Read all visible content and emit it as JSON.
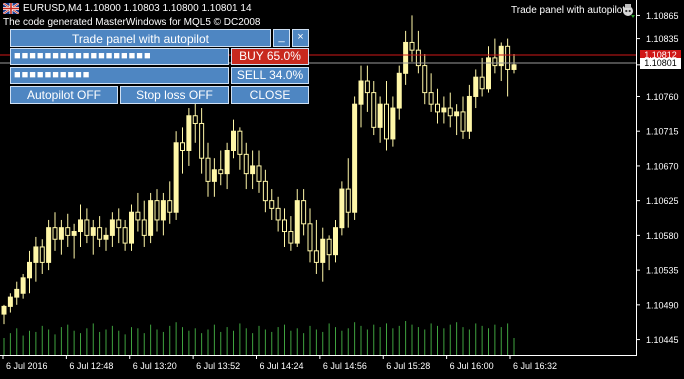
{
  "header": {
    "symbol_line": "EURUSD,M4  1.10800 1.10803 1.10800 1.10801  14",
    "copyright": "The code generated MasterWindows for MQL5 © DC2008",
    "indicator_label": "Trade panel with autopilot"
  },
  "panel": {
    "title": "Trade panel with autopilot",
    "minimize_label": "_",
    "close_label": "×",
    "buy_bar": "■■■■■■■■■■■■■■■■■■",
    "sell_bar": "■■■■■■■■■■",
    "buy_label": "BUY 65.0%",
    "sell_label": "SELL 34.0%",
    "buy_percent": 65.0,
    "sell_percent": 34.0,
    "autopilot_label": "Autopilot  OFF",
    "stoploss_label": "Stop loss  OFF",
    "close_button_label": "CLOSE"
  },
  "colors": {
    "background": "#000000",
    "bull_candle": "#fff7a8",
    "bear_candle": "#000000",
    "volume": "#3fa33f",
    "ask_line": "#d01818",
    "bid_line": "#9a9a9a",
    "panel": "#4e86c2",
    "buy": "#c8291e"
  },
  "price_labels": {
    "ask": "1.10812",
    "bid": "1.10801"
  },
  "chart_data": {
    "type": "candlestick",
    "title": "EURUSD,M4",
    "ylim": [
      1.10425,
      1.10885
    ],
    "y_ticks": [
      "1.10865",
      "1.10835",
      "1.10801",
      "1.10760",
      "1.10715",
      "1.10670",
      "1.10625",
      "1.10580",
      "1.10535",
      "1.10490",
      "1.10445"
    ],
    "x_ticks": [
      "6 Jul 2016",
      "6 Jul 12:48",
      "6 Jul 13:20",
      "6 Jul 13:52",
      "6 Jul 14:24",
      "6 Jul 14:56",
      "6 Jul 15:28",
      "6 Jul 16:00",
      "6 Jul 16:32"
    ],
    "ask": 1.10812,
    "bid": 1.10801,
    "candles": [
      [
        1.10478,
        1.1049,
        1.10465,
        1.10488
      ],
      [
        1.10488,
        1.10505,
        1.1048,
        1.105
      ],
      [
        1.105,
        1.1052,
        1.1049,
        1.1051
      ],
      [
        1.10505,
        1.1053,
        1.10498,
        1.10525
      ],
      [
        1.10525,
        1.1056,
        1.10505,
        1.10545
      ],
      [
        1.10545,
        1.10578,
        1.1052,
        1.10565
      ],
      [
        1.10565,
        1.10575,
        1.1053,
        1.10545
      ],
      [
        1.10545,
        1.106,
        1.10535,
        1.1059
      ],
      [
        1.1059,
        1.1061,
        1.1056,
        1.10575
      ],
      [
        1.10575,
        1.106,
        1.10555,
        1.1059
      ],
      [
        1.1059,
        1.10608,
        1.10565,
        1.1058
      ],
      [
        1.1058,
        1.10595,
        1.1055,
        1.10585
      ],
      [
        1.10585,
        1.1062,
        1.10565,
        1.106
      ],
      [
        1.106,
        1.10615,
        1.1057,
        1.1058
      ],
      [
        1.1058,
        1.106,
        1.10555,
        1.1059
      ],
      [
        1.1059,
        1.10605,
        1.10565,
        1.10575
      ],
      [
        1.10575,
        1.1059,
        1.1056,
        1.1058
      ],
      [
        1.1058,
        1.1061,
        1.10565,
        1.106
      ],
      [
        1.106,
        1.10615,
        1.1057,
        1.1059
      ],
      [
        1.1059,
        1.106,
        1.1056,
        1.1057
      ],
      [
        1.1057,
        1.1062,
        1.1056,
        1.1061
      ],
      [
        1.1061,
        1.10635,
        1.10585,
        1.106
      ],
      [
        1.106,
        1.10625,
        1.10565,
        1.1058
      ],
      [
        1.1058,
        1.10635,
        1.1057,
        1.10625
      ],
      [
        1.10625,
        1.1064,
        1.10585,
        1.106
      ],
      [
        1.106,
        1.10635,
        1.1058,
        1.10625
      ],
      [
        1.10625,
        1.1065,
        1.10595,
        1.1061
      ],
      [
        1.1061,
        1.10715,
        1.106,
        1.107
      ],
      [
        1.107,
        1.1072,
        1.1066,
        1.1069
      ],
      [
        1.1069,
        1.10745,
        1.1067,
        1.10735
      ],
      [
        1.10735,
        1.1076,
        1.107,
        1.10725
      ],
      [
        1.10725,
        1.10745,
        1.1066,
        1.1068
      ],
      [
        1.1068,
        1.107,
        1.1063,
        1.1065
      ],
      [
        1.1065,
        1.1068,
        1.1063,
        1.10665
      ],
      [
        1.10665,
        1.1069,
        1.10645,
        1.1066
      ],
      [
        1.1066,
        1.107,
        1.1064,
        1.1069
      ],
      [
        1.1069,
        1.1073,
        1.1068,
        1.10715
      ],
      [
        1.10715,
        1.1072,
        1.10665,
        1.10685
      ],
      [
        1.10685,
        1.107,
        1.1064,
        1.1066
      ],
      [
        1.1066,
        1.1069,
        1.1064,
        1.1067
      ],
      [
        1.1067,
        1.1069,
        1.10635,
        1.1065
      ],
      [
        1.1065,
        1.10665,
        1.1061,
        1.10625
      ],
      [
        1.10625,
        1.1064,
        1.106,
        1.10615
      ],
      [
        1.10615,
        1.1063,
        1.10585,
        1.106
      ],
      [
        1.106,
        1.10615,
        1.10565,
        1.10585
      ],
      [
        1.10585,
        1.10605,
        1.1056,
        1.1057
      ],
      [
        1.1057,
        1.1064,
        1.10565,
        1.10625
      ],
      [
        1.10625,
        1.1064,
        1.1058,
        1.10595
      ],
      [
        1.10595,
        1.10615,
        1.10545,
        1.1056
      ],
      [
        1.1056,
        1.106,
        1.1053,
        1.10545
      ],
      [
        1.10545,
        1.1059,
        1.1052,
        1.10575
      ],
      [
        1.10575,
        1.1058,
        1.10535,
        1.10555
      ],
      [
        1.10555,
        1.106,
        1.10545,
        1.1059
      ],
      [
        1.1059,
        1.1065,
        1.1058,
        1.1064
      ],
      [
        1.1064,
        1.1068,
        1.1059,
        1.1061
      ],
      [
        1.1061,
        1.1076,
        1.106,
        1.1075
      ],
      [
        1.1075,
        1.108,
        1.1072,
        1.1078
      ],
      [
        1.1078,
        1.108,
        1.1074,
        1.10765
      ],
      [
        1.10765,
        1.1078,
        1.1071,
        1.1072
      ],
      [
        1.1072,
        1.1076,
        1.107,
        1.1075
      ],
      [
        1.1075,
        1.1078,
        1.1069,
        1.10705
      ],
      [
        1.10705,
        1.1076,
        1.10695,
        1.10745
      ],
      [
        1.10745,
        1.108,
        1.1073,
        1.1079
      ],
      [
        1.1079,
        1.10845,
        1.10775,
        1.1083
      ],
      [
        1.1083,
        1.10865,
        1.10805,
        1.1082
      ],
      [
        1.1082,
        1.10845,
        1.1079,
        1.108
      ],
      [
        1.108,
        1.10815,
        1.1075,
        1.10765
      ],
      [
        1.10765,
        1.1079,
        1.1074,
        1.1075
      ],
      [
        1.1075,
        1.1077,
        1.10725,
        1.1074
      ],
      [
        1.1074,
        1.1076,
        1.10725,
        1.10745
      ],
      [
        1.10745,
        1.10765,
        1.1072,
        1.10735
      ],
      [
        1.10735,
        1.1075,
        1.1071,
        1.1074
      ],
      [
        1.1074,
        1.1076,
        1.10705,
        1.10715
      ],
      [
        1.10715,
        1.10775,
        1.10705,
        1.1076
      ],
      [
        1.1076,
        1.10795,
        1.10745,
        1.10785
      ],
      [
        1.10785,
        1.1081,
        1.1076,
        1.1077
      ],
      [
        1.1077,
        1.10825,
        1.10765,
        1.1081
      ],
      [
        1.1081,
        1.10835,
        1.1079,
        1.108
      ],
      [
        1.108,
        1.1083,
        1.1078,
        1.10825
      ],
      [
        1.10825,
        1.10835,
        1.1076,
        1.10795
      ],
      [
        1.10795,
        1.10815,
        1.1079,
        1.10801
      ]
    ],
    "volumes": [
      14,
      18,
      22,
      16,
      20,
      19,
      24,
      21,
      17,
      23,
      25,
      20,
      18,
      22,
      26,
      19,
      21,
      24,
      20,
      17,
      23,
      22,
      18,
      25,
      21,
      19,
      24,
      27,
      23,
      20,
      22,
      18,
      21,
      25,
      19,
      23,
      20,
      26,
      22,
      18,
      24,
      21,
      19,
      23,
      25,
      20,
      22,
      18,
      24,
      21,
      19,
      26,
      23,
      20,
      22,
      27,
      24,
      21,
      25,
      23,
      26,
      22,
      24,
      28,
      25,
      23,
      21,
      26,
      24,
      22,
      25,
      27,
      23,
      21,
      26,
      24,
      22,
      25,
      23,
      26,
      14
    ]
  }
}
